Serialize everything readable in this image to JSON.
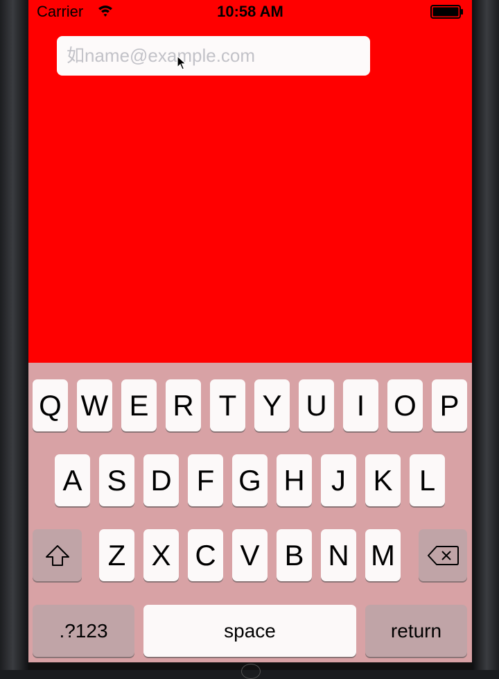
{
  "status_bar": {
    "carrier": "Carrier",
    "time": "10:58 AM",
    "wifi_icon": "wifi-icon",
    "battery_icon": "battery-full-icon"
  },
  "email_field": {
    "placeholder": "如name@example.com",
    "value": ""
  },
  "colors": {
    "background": "#ff0000",
    "keyboard": "#d8a2a5",
    "key": "#fcf9f9",
    "function_key": "#c0a4a7"
  },
  "keyboard": {
    "row1": [
      "Q",
      "W",
      "E",
      "R",
      "T",
      "Y",
      "U",
      "I",
      "O",
      "P"
    ],
    "row2": [
      "A",
      "S",
      "D",
      "F",
      "G",
      "H",
      "J",
      "K",
      "L"
    ],
    "row3": [
      "Z",
      "X",
      "C",
      "V",
      "B",
      "N",
      "M"
    ],
    "shift_icon": "shift-icon",
    "delete_icon": "backspace-icon",
    "numbers_label": ".?123",
    "space_label": "space",
    "return_label": "return"
  }
}
